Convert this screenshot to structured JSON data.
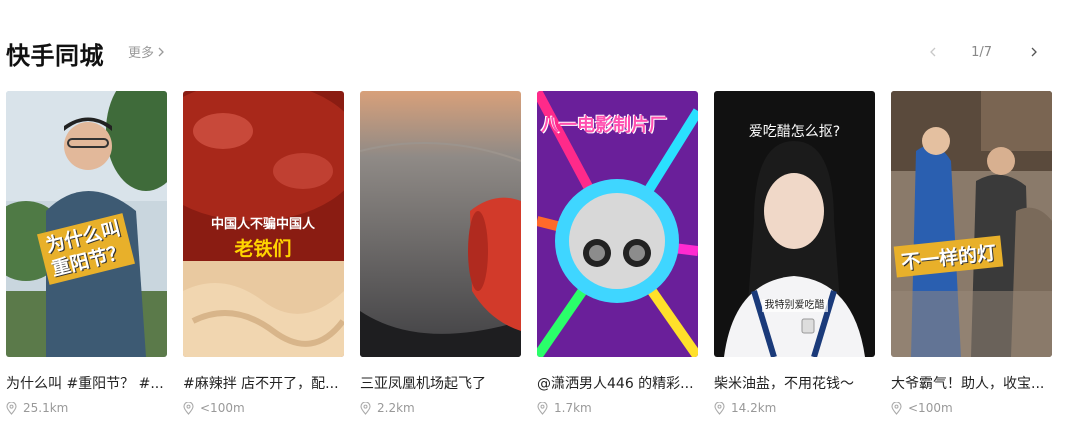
{
  "header": {
    "title": "快手同城",
    "more_label": "更多",
    "page_indicator": "1/7"
  },
  "cards": [
    {
      "caption": "为什么叫 #重阳节？ #...",
      "distance": "25.1km",
      "overlay_lines": [
        "为什么叫",
        "重阳节？"
      ]
    },
    {
      "caption": "#麻辣拌 店不开了，配...",
      "distance": "<100m",
      "overlay_lines": [
        "中国人不骗中国人",
        "老铁们"
      ]
    },
    {
      "caption": "三亚凤凰机场起飞了",
      "distance": "2.2km",
      "overlay_lines": []
    },
    {
      "caption": "@潇洒男人446 的精彩...",
      "distance": "1.7km",
      "overlay_lines": [
        "八一电影制片厂"
      ]
    },
    {
      "caption": "柴米油盐，不用花钱～",
      "distance": "14.2km",
      "overlay_lines": [
        "爱吃醋怎么抠?",
        "我特别爱吃醋"
      ]
    },
    {
      "caption": "大爷霸气！助人，收宝...",
      "distance": "<100m",
      "overlay_lines": [
        "不一样的灯"
      ]
    }
  ]
}
